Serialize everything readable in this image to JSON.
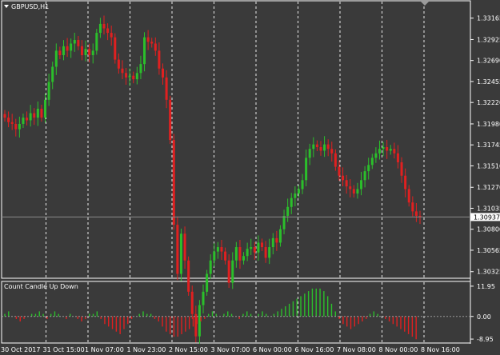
{
  "window": {
    "symbol_title": "GBPUSD,H1"
  },
  "current_price_label": "1.30937",
  "colors": {
    "background": "#3a3a3a",
    "grid": "#ffffff",
    "bull": "#2bbf2b",
    "bear": "#e02020",
    "text": "#ffffff",
    "price_line": "#8a8a8a"
  },
  "chart_data": [
    {
      "type": "candlestick",
      "title": "GBPUSD,H1",
      "y_ticks": [
        "1.33165",
        "1.32925",
        "1.32690",
        "1.32455",
        "1.32220",
        "1.31980",
        "1.31745",
        "1.31510",
        "1.31270",
        "1.31035",
        "1.30800",
        "1.30565",
        "1.30325"
      ],
      "y_tick_values": [
        1.33165,
        1.32925,
        1.3269,
        1.32455,
        1.3222,
        1.3198,
        1.31745,
        1.3151,
        1.3127,
        1.31035,
        1.308,
        1.30565,
        1.30325
      ],
      "ylim": [
        1.3026,
        1.3335
      ],
      "current_price": 1.30937,
      "x_ticks": [
        "30 Oct 2017",
        "31 Oct 15:00",
        "1 Nov 07:00",
        "1 Nov 23:00",
        "2 Nov 15:00",
        "3 Nov 07:00",
        "6 Nov 00:00",
        "6 Nov 16:00",
        "7 Nov 08:00",
        "8 Nov 00:00",
        "8 Nov 16:00"
      ],
      "closes": [
        1.3205,
        1.32,
        1.3198,
        1.3192,
        1.3198,
        1.3205,
        1.3202,
        1.321,
        1.3205,
        1.3215,
        1.3205,
        1.3225,
        1.3245,
        1.3262,
        1.328,
        1.3275,
        1.3285,
        1.328,
        1.3288,
        1.3292,
        1.3285,
        1.3275,
        1.3282,
        1.3275,
        1.328,
        1.33,
        1.331,
        1.3305,
        1.33,
        1.3295,
        1.327,
        1.326,
        1.3255,
        1.325,
        1.3252,
        1.3248,
        1.3255,
        1.3265,
        1.3295,
        1.329,
        1.3288,
        1.328,
        1.326,
        1.325,
        1.3225,
        1.318,
        1.3085,
        1.303,
        1.3075,
        1.3045,
        1.301,
        1.2985,
        1.296,
        1.2995,
        1.301,
        1.303,
        1.3045,
        1.3055,
        1.306,
        1.3055,
        1.3045,
        1.302,
        1.3045,
        1.306,
        1.3045,
        1.305,
        1.3058,
        1.306,
        1.3054,
        1.3065,
        1.306,
        1.3048,
        1.306,
        1.307,
        1.3065,
        1.308,
        1.3095,
        1.3105,
        1.3115,
        1.312,
        1.3125,
        1.3135,
        1.316,
        1.317,
        1.3175,
        1.3172,
        1.3168,
        1.3175,
        1.317,
        1.3165,
        1.315,
        1.314,
        1.3135,
        1.3128,
        1.3125,
        1.312,
        1.3125,
        1.3135,
        1.3145,
        1.3152,
        1.316,
        1.3165,
        1.317,
        1.3172,
        1.3168,
        1.317,
        1.3165,
        1.3155,
        1.314,
        1.3125,
        1.311,
        1.31,
        1.3095,
        1.3094
      ]
    },
    {
      "type": "bar",
      "title": "Count Candle Up Down",
      "y_ticks": [
        "11.95",
        "0.00",
        "-8.95"
      ],
      "y_tick_values": [
        11.95,
        0.0,
        -8.95
      ],
      "ylim": [
        -10.5,
        13.5
      ],
      "values": [
        1,
        2,
        0,
        -1,
        -2,
        -1,
        0,
        1,
        1,
        2,
        1,
        -1,
        1,
        2,
        1,
        0,
        -1,
        1,
        0,
        -1,
        -2,
        -1,
        1,
        1,
        2,
        -1,
        -3,
        -4,
        -5,
        -6,
        -7,
        -5,
        -3,
        -1,
        0,
        1,
        2,
        1,
        1,
        -1,
        -2,
        -4,
        -6,
        -7,
        -8,
        -8,
        -7,
        -6,
        -5,
        -4,
        -3,
        -2,
        -1,
        1,
        2,
        1,
        0,
        1,
        2,
        1,
        0,
        -1,
        1,
        2,
        1,
        0,
        1,
        2,
        1,
        0,
        1,
        2,
        3,
        4,
        5,
        6,
        7,
        8,
        9,
        10,
        11,
        11,
        11,
        10,
        8,
        5,
        2,
        -1,
        -3,
        -4,
        -5,
        -4,
        -3,
        -2,
        -1,
        1,
        2,
        1,
        0,
        -1,
        -2,
        -3,
        -4,
        -5,
        -6,
        -7,
        -8,
        -9,
        0
      ]
    }
  ]
}
